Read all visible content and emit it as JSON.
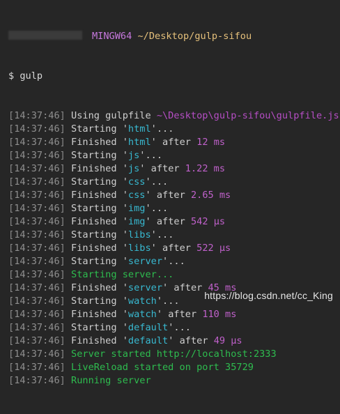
{
  "colors": {
    "background": "#262626",
    "timestamp": "#8f8f8f",
    "text": "#cfcfcf",
    "task_name": "#38b9d1",
    "duration": "#c061cb",
    "success": "#2ebc4f",
    "mingw": "#c678dd",
    "path": "#e5c07b"
  },
  "header": {
    "shell": "MINGW64",
    "cwd": "~/Desktop/gulp-sifou"
  },
  "prompt": {
    "symbol": "$",
    "command": "gulp"
  },
  "timestamp": "14:37:46",
  "using_gulpfile": {
    "text": "Using gulpfile",
    "path": "~\\Desktop\\gulp-sifou\\gulpfile.js"
  },
  "tasks": [
    {
      "name": "html",
      "duration": "12 ms"
    },
    {
      "name": "js",
      "duration": "1.22 ms"
    },
    {
      "name": "css",
      "duration": "2.65 ms"
    },
    {
      "name": "img",
      "duration": "542 μs"
    },
    {
      "name": "libs",
      "duration": "522 μs"
    },
    {
      "name": "server",
      "duration": "45 ms"
    },
    {
      "name": "watch",
      "duration": "110 ms"
    },
    {
      "name": "default",
      "duration": "49 μs"
    }
  ],
  "words": {
    "starting": "Starting",
    "finished": "Finished",
    "after": "after",
    "ellipsis": "..."
  },
  "server_messages": {
    "starting_server": "Starting server...",
    "server_started": "Server started http://localhost:2333",
    "livereload": "LiveReload started on port 35729",
    "running": "Running server"
  },
  "watermark": "https://blog.csdn.net/cc_King"
}
